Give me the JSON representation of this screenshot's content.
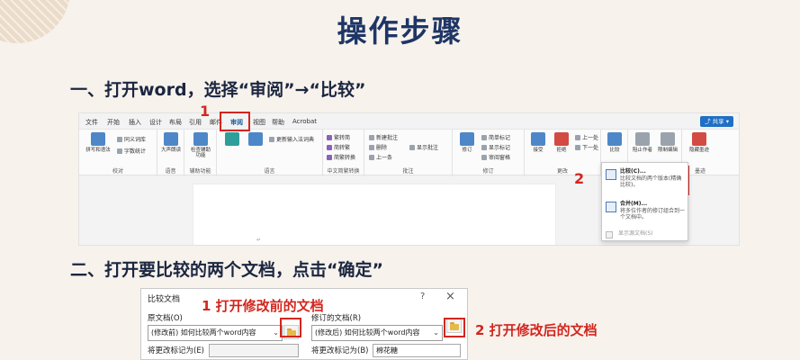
{
  "title": "操作步骤",
  "step1": "一、打开word，选择“审阅”→“比较”",
  "step2": "二、打开要比较的两个文档，点击“确定”",
  "word": {
    "tabs": [
      "文件",
      "开始",
      "插入",
      "设计",
      "布局",
      "引用",
      "邮件",
      "审阅",
      "视图",
      "帮助",
      "Acrobat"
    ],
    "active_tab": "审阅",
    "share": "共享",
    "ribbon": {
      "proof_items": [
        "拼写和语法",
        "同义词库",
        "字数统计"
      ],
      "proof_label": "校对",
      "speech_item": "大声朗读",
      "speech_label": "语音",
      "access_item": "检查辅助功能",
      "access_label": "辅助功能",
      "translate_item": "更新输入法词典",
      "lang_label": "语言",
      "chinese_items": [
        "繁转简",
        "简转繁",
        "简繁转换"
      ],
      "chinese_label": "中文简繁转换",
      "comment_items": [
        "新建批注",
        "删除",
        "上一条",
        "显示批注"
      ],
      "comment_label": "批注",
      "track_items": [
        "修订",
        "简单标记",
        "显示标记",
        "审阅窗格"
      ],
      "track_label": "修订",
      "changes_items": [
        "接受",
        "拒绝",
        "上一处",
        "下一处"
      ],
      "changes_label": "更改",
      "compare_item": "比较",
      "protect_items": [
        "阻止作者",
        "限制编辑"
      ],
      "ink_item": "隐藏墨迹",
      "ink_label": "墨迹"
    },
    "dropdown": {
      "compare_title": "比较(C)...",
      "compare_desc": "比较文档的两个版本(精确比较)。",
      "combine_title": "合并(M)...",
      "combine_desc": "将多位作者的修订组合到一个文档中。",
      "show_source": "显示源文档(S)"
    },
    "marker1": "1",
    "marker2": "2"
  },
  "dialog": {
    "title": "比较文档",
    "help": "?",
    "close": "×",
    "original_label": "原文档(O)",
    "original_value": "(修改前) 如何比较两个word内容",
    "revised_label": "修订的文档(R)",
    "revised_value": "(修改后) 如何比较两个word内容",
    "mark_label_left": "将更改标记为(E)",
    "mark_label_right": "将更改标记为(B)",
    "mark_value_right": "棉花糖"
  },
  "annotations": {
    "open_before": "1 打开修改前的文档",
    "open_after": "2 打开修改后的文档"
  }
}
